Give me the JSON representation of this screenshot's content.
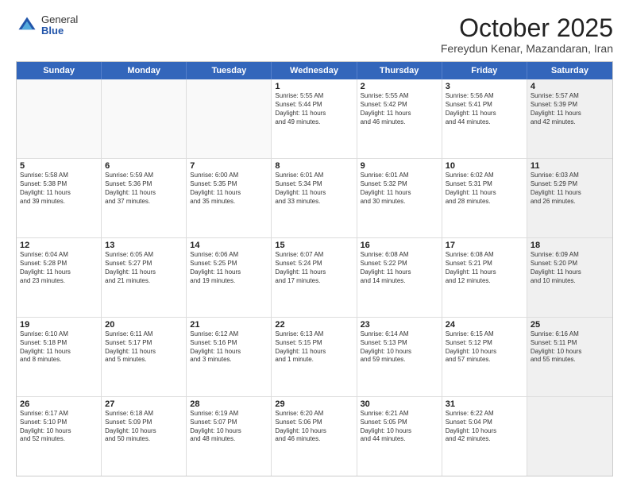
{
  "logo": {
    "general": "General",
    "blue": "Blue"
  },
  "title": {
    "month": "October 2025",
    "location": "Fereydun Kenar, Mazandaran, Iran"
  },
  "header": {
    "days": [
      "Sunday",
      "Monday",
      "Tuesday",
      "Wednesday",
      "Thursday",
      "Friday",
      "Saturday"
    ]
  },
  "rows": [
    [
      {
        "day": "",
        "lines": [],
        "empty": true
      },
      {
        "day": "",
        "lines": [],
        "empty": true
      },
      {
        "day": "",
        "lines": [],
        "empty": true
      },
      {
        "day": "1",
        "lines": [
          "Sunrise: 5:55 AM",
          "Sunset: 5:44 PM",
          "Daylight: 11 hours",
          "and 49 minutes."
        ]
      },
      {
        "day": "2",
        "lines": [
          "Sunrise: 5:55 AM",
          "Sunset: 5:42 PM",
          "Daylight: 11 hours",
          "and 46 minutes."
        ]
      },
      {
        "day": "3",
        "lines": [
          "Sunrise: 5:56 AM",
          "Sunset: 5:41 PM",
          "Daylight: 11 hours",
          "and 44 minutes."
        ]
      },
      {
        "day": "4",
        "lines": [
          "Sunrise: 5:57 AM",
          "Sunset: 5:39 PM",
          "Daylight: 11 hours",
          "and 42 minutes."
        ],
        "shaded": true
      }
    ],
    [
      {
        "day": "5",
        "lines": [
          "Sunrise: 5:58 AM",
          "Sunset: 5:38 PM",
          "Daylight: 11 hours",
          "and 39 minutes."
        ]
      },
      {
        "day": "6",
        "lines": [
          "Sunrise: 5:59 AM",
          "Sunset: 5:36 PM",
          "Daylight: 11 hours",
          "and 37 minutes."
        ]
      },
      {
        "day": "7",
        "lines": [
          "Sunrise: 6:00 AM",
          "Sunset: 5:35 PM",
          "Daylight: 11 hours",
          "and 35 minutes."
        ]
      },
      {
        "day": "8",
        "lines": [
          "Sunrise: 6:01 AM",
          "Sunset: 5:34 PM",
          "Daylight: 11 hours",
          "and 33 minutes."
        ]
      },
      {
        "day": "9",
        "lines": [
          "Sunrise: 6:01 AM",
          "Sunset: 5:32 PM",
          "Daylight: 11 hours",
          "and 30 minutes."
        ]
      },
      {
        "day": "10",
        "lines": [
          "Sunrise: 6:02 AM",
          "Sunset: 5:31 PM",
          "Daylight: 11 hours",
          "and 28 minutes."
        ]
      },
      {
        "day": "11",
        "lines": [
          "Sunrise: 6:03 AM",
          "Sunset: 5:29 PM",
          "Daylight: 11 hours",
          "and 26 minutes."
        ],
        "shaded": true
      }
    ],
    [
      {
        "day": "12",
        "lines": [
          "Sunrise: 6:04 AM",
          "Sunset: 5:28 PM",
          "Daylight: 11 hours",
          "and 23 minutes."
        ]
      },
      {
        "day": "13",
        "lines": [
          "Sunrise: 6:05 AM",
          "Sunset: 5:27 PM",
          "Daylight: 11 hours",
          "and 21 minutes."
        ]
      },
      {
        "day": "14",
        "lines": [
          "Sunrise: 6:06 AM",
          "Sunset: 5:25 PM",
          "Daylight: 11 hours",
          "and 19 minutes."
        ]
      },
      {
        "day": "15",
        "lines": [
          "Sunrise: 6:07 AM",
          "Sunset: 5:24 PM",
          "Daylight: 11 hours",
          "and 17 minutes."
        ]
      },
      {
        "day": "16",
        "lines": [
          "Sunrise: 6:08 AM",
          "Sunset: 5:22 PM",
          "Daylight: 11 hours",
          "and 14 minutes."
        ]
      },
      {
        "day": "17",
        "lines": [
          "Sunrise: 6:08 AM",
          "Sunset: 5:21 PM",
          "Daylight: 11 hours",
          "and 12 minutes."
        ]
      },
      {
        "day": "18",
        "lines": [
          "Sunrise: 6:09 AM",
          "Sunset: 5:20 PM",
          "Daylight: 11 hours",
          "and 10 minutes."
        ],
        "shaded": true
      }
    ],
    [
      {
        "day": "19",
        "lines": [
          "Sunrise: 6:10 AM",
          "Sunset: 5:18 PM",
          "Daylight: 11 hours",
          "and 8 minutes."
        ]
      },
      {
        "day": "20",
        "lines": [
          "Sunrise: 6:11 AM",
          "Sunset: 5:17 PM",
          "Daylight: 11 hours",
          "and 5 minutes."
        ]
      },
      {
        "day": "21",
        "lines": [
          "Sunrise: 6:12 AM",
          "Sunset: 5:16 PM",
          "Daylight: 11 hours",
          "and 3 minutes."
        ]
      },
      {
        "day": "22",
        "lines": [
          "Sunrise: 6:13 AM",
          "Sunset: 5:15 PM",
          "Daylight: 11 hours",
          "and 1 minute."
        ]
      },
      {
        "day": "23",
        "lines": [
          "Sunrise: 6:14 AM",
          "Sunset: 5:13 PM",
          "Daylight: 10 hours",
          "and 59 minutes."
        ]
      },
      {
        "day": "24",
        "lines": [
          "Sunrise: 6:15 AM",
          "Sunset: 5:12 PM",
          "Daylight: 10 hours",
          "and 57 minutes."
        ]
      },
      {
        "day": "25",
        "lines": [
          "Sunrise: 6:16 AM",
          "Sunset: 5:11 PM",
          "Daylight: 10 hours",
          "and 55 minutes."
        ],
        "shaded": true
      }
    ],
    [
      {
        "day": "26",
        "lines": [
          "Sunrise: 6:17 AM",
          "Sunset: 5:10 PM",
          "Daylight: 10 hours",
          "and 52 minutes."
        ]
      },
      {
        "day": "27",
        "lines": [
          "Sunrise: 6:18 AM",
          "Sunset: 5:09 PM",
          "Daylight: 10 hours",
          "and 50 minutes."
        ]
      },
      {
        "day": "28",
        "lines": [
          "Sunrise: 6:19 AM",
          "Sunset: 5:07 PM",
          "Daylight: 10 hours",
          "and 48 minutes."
        ]
      },
      {
        "day": "29",
        "lines": [
          "Sunrise: 6:20 AM",
          "Sunset: 5:06 PM",
          "Daylight: 10 hours",
          "and 46 minutes."
        ]
      },
      {
        "day": "30",
        "lines": [
          "Sunrise: 6:21 AM",
          "Sunset: 5:05 PM",
          "Daylight: 10 hours",
          "and 44 minutes."
        ]
      },
      {
        "day": "31",
        "lines": [
          "Sunrise: 6:22 AM",
          "Sunset: 5:04 PM",
          "Daylight: 10 hours",
          "and 42 minutes."
        ]
      },
      {
        "day": "",
        "lines": [],
        "empty": true,
        "shaded": true
      }
    ]
  ]
}
